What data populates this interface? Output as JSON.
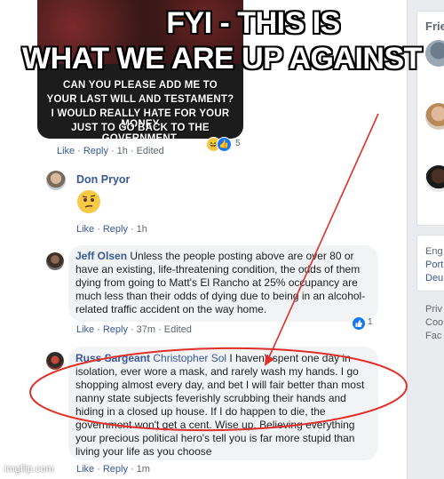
{
  "overlay": {
    "line1": "FYI - THIS IS",
    "line2": "WHAT WE ARE UP AGAINST"
  },
  "meme": {
    "lines": [
      "CAN YOU PLEASE ADD ME TO",
      "YOUR LAST WILL AND TESTAMENT?",
      "I WOULD REALLY HATE FOR YOUR MONEY",
      "JUST TO GO BACK TO THE GOVERNMENT."
    ],
    "reaction_count": "5"
  },
  "comment0_actions": {
    "like": "Like",
    "reply": "Reply",
    "time": "1h",
    "edited": "Edited"
  },
  "comment1": {
    "author": "Don Pryor",
    "actions": {
      "like": "Like",
      "reply": "Reply",
      "time": "1h"
    }
  },
  "comment2": {
    "author": "Jeff Olsen",
    "lines": [
      " Unless the people posting above are over 80 or",
      "have an existing, life-threatening condition, the odds of them",
      "dying from going to Matt's El Rancho at 25% occupancy are",
      "much less than their odds of dying due to being in an alcohol-",
      "related traffic accident on the way home."
    ],
    "like_count": "1",
    "actions": {
      "like": "Like",
      "reply": "Reply",
      "time": "37m",
      "edited": "Edited"
    }
  },
  "comment3": {
    "author": "Russ Sargeant",
    "tag": "Christopher Sol",
    "first": " I haven't spent one day in",
    "lines": [
      "isolation, ever wore a mask, and rarely wash my hands. I go",
      "shopping almost every day, and bet I will fair better than most",
      "nanny state subjects feverishly scrubbing their hands and",
      "hiding in a closed up house. If I do happen to die, the",
      "government won't get a cent. Wise up. Believing everything",
      "your precious political hero's tell you is far more stupid than",
      "living your life as you choose"
    ],
    "actions": {
      "like": "Like",
      "reply": "Reply",
      "time": "1m"
    }
  },
  "sidebar": {
    "title": "Frie",
    "links": [
      "Eng",
      "Port",
      "Deu"
    ],
    "footer": [
      "Priv",
      "Coo",
      "Fac"
    ]
  },
  "watermark": "imgflip.com",
  "colors": {
    "link": "#385898",
    "annotation_red": "#e0302c",
    "bubble": "#f2f3f5"
  }
}
